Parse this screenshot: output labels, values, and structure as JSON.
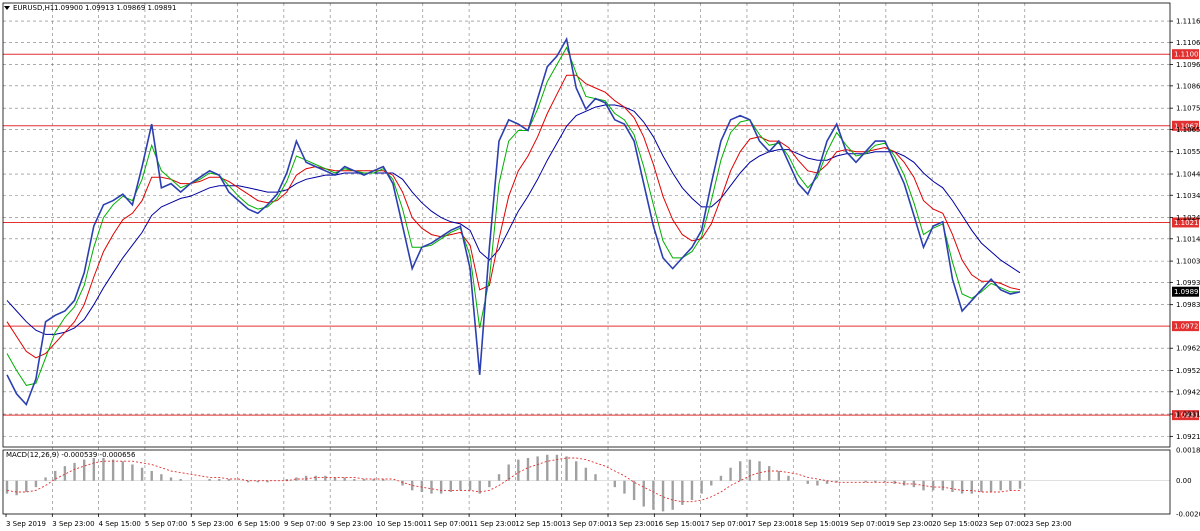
{
  "header": {
    "symbol_label": "EURUSD,H1",
    "ohlc_text": "1.09900 1.09913 1.09869 1.09891",
    "indicator_label": "MACD(12,26,9) -0.000539 -0.000656"
  },
  "colors": {
    "price": "#2b3fb0",
    "ma_fast": "#00b000",
    "ma_mid": "#e00000",
    "ma_slow": "#0000a0",
    "level_line": "#e03030",
    "grid": "#7a7a7a",
    "macd_hist": "#a0a0a0",
    "macd_signal": "#e03030"
  },
  "chart_data": {
    "type": "line",
    "price_axis_ticks": [
      "1.11165",
      "1.11065",
      "1.10960",
      "1.10860",
      "1.10755",
      "1.10655",
      "1.10550",
      "1.10445",
      "1.10345",
      "1.10240",
      "1.10140",
      "1.10035",
      "1.09935",
      "1.09830",
      "1.09625",
      "1.09520",
      "1.09420",
      "1.09315",
      "1.09210"
    ],
    "price_range": [
      1.0916,
      1.1125
    ],
    "current_price": "1.09891",
    "levels": [
      {
        "price": 1.11009,
        "label": "1.11009"
      },
      {
        "price": 1.10672,
        "label": "1.10672"
      },
      {
        "price": 1.10217,
        "label": "1.10217"
      },
      {
        "price": 1.09729,
        "label": "1.09729"
      },
      {
        "price": 1.0931,
        "label": "1.09310"
      }
    ],
    "time_labels": [
      "3 Sep 2019",
      "3 Sep 23:00",
      "4 Sep 15:00",
      "5 Sep 07:00",
      "5 Sep 23:00",
      "6 Sep 15:00",
      "9 Sep 07:00",
      "9 Sep 23:00",
      "10 Sep 15:00",
      "11 Sep 07:00",
      "11 Sep 23:00",
      "12 Sep 15:00",
      "13 Sep 07:00",
      "13 Sep 23:00",
      "16 Sep 15:00",
      "17 Sep 07:00",
      "17 Sep 23:00",
      "18 Sep 15:00",
      "19 Sep 07:00",
      "19 Sep 23:00",
      "20 Sep 15:00",
      "23 Sep 07:00",
      "23 Sep 23:00"
    ],
    "series": [
      {
        "key": "price",
        "values": [
          1.095,
          1.0941,
          1.0936,
          1.0948,
          1.0975,
          1.0978,
          1.098,
          1.0985,
          1.0998,
          1.102,
          1.103,
          1.1032,
          1.1035,
          1.103,
          1.1048,
          1.1068,
          1.1038,
          1.104,
          1.1036,
          1.104,
          1.1043,
          1.1046,
          1.1044,
          1.1036,
          1.1032,
          1.1028,
          1.1026,
          1.103,
          1.1035,
          1.1045,
          1.106,
          1.105,
          1.1048,
          1.1046,
          1.1044,
          1.1048,
          1.1046,
          1.1044,
          1.1046,
          1.1048,
          1.104,
          1.102,
          1.1,
          1.101,
          1.1012,
          1.1015,
          1.1018,
          1.102,
          1.1,
          1.095,
          1.101,
          1.106,
          1.107,
          1.1068,
          1.1065,
          1.108,
          1.1095,
          1.11,
          1.1108,
          1.1085,
          1.1075,
          1.108,
          1.1078,
          1.107,
          1.1068,
          1.106,
          1.104,
          1.102,
          1.1005,
          1.1,
          1.1005,
          1.101,
          1.1018,
          1.104,
          1.106,
          1.107,
          1.1072,
          1.107,
          1.106,
          1.1055,
          1.106,
          1.105,
          1.104,
          1.1035,
          1.1045,
          1.106,
          1.1068,
          1.1055,
          1.105,
          1.1055,
          1.106,
          1.106,
          1.105,
          1.104,
          1.1025,
          1.101,
          1.102,
          1.1022,
          1.0995,
          1.098,
          1.0985,
          1.099,
          1.0995,
          1.099,
          1.0988,
          1.0989
        ]
      },
      {
        "key": "ma_fast",
        "values": [
          1.096,
          1.0952,
          1.0945,
          1.0946,
          1.0958,
          1.097,
          1.0977,
          1.0982,
          1.0992,
          1.101,
          1.1024,
          1.103,
          1.1034,
          1.1032,
          1.1042,
          1.1058,
          1.1046,
          1.1042,
          1.1038,
          1.104,
          1.1042,
          1.1045,
          1.1044,
          1.1039,
          1.1034,
          1.103,
          1.1028,
          1.1029,
          1.1033,
          1.1041,
          1.1053,
          1.1051,
          1.1049,
          1.1047,
          1.1045,
          1.1047,
          1.1046,
          1.1045,
          1.1045,
          1.1047,
          1.1042,
          1.1028,
          1.101,
          1.101,
          1.1011,
          1.1014,
          1.1017,
          1.1019,
          1.1006,
          1.0972,
          1.0995,
          1.104,
          1.106,
          1.1065,
          1.1065,
          1.1075,
          1.1088,
          1.1096,
          1.1104,
          1.1092,
          1.1081,
          1.108,
          1.1079,
          1.1073,
          1.107,
          1.1063,
          1.1048,
          1.103,
          1.1013,
          1.1005,
          1.1005,
          1.1008,
          1.1015,
          1.1032,
          1.1051,
          1.1064,
          1.1069,
          1.107,
          1.1063,
          1.1058,
          1.1059,
          1.1053,
          1.1044,
          1.1038,
          1.1043,
          1.1055,
          1.1064,
          1.1058,
          1.1053,
          1.1054,
          1.1058,
          1.1059,
          1.1053,
          1.1044,
          1.1031,
          1.1016,
          1.1019,
          1.1021,
          1.1003,
          1.0988,
          1.0986,
          1.0989,
          1.0993,
          1.0991,
          1.0989,
          1.0989
        ]
      },
      {
        "key": "ma_mid",
        "values": [
          1.0975,
          1.0968,
          1.0961,
          1.0958,
          1.096,
          1.0965,
          1.097,
          1.0975,
          1.0983,
          1.0996,
          1.1008,
          1.1016,
          1.1023,
          1.1026,
          1.1032,
          1.1043,
          1.1043,
          1.1042,
          1.104,
          1.104,
          1.1041,
          1.1043,
          1.1043,
          1.1041,
          1.1038,
          1.1035,
          1.1032,
          1.1031,
          1.1032,
          1.1036,
          1.1044,
          1.1047,
          1.1048,
          1.1047,
          1.1046,
          1.1046,
          1.1046,
          1.1046,
          1.1046,
          1.1046,
          1.1044,
          1.1036,
          1.1024,
          1.1019,
          1.1016,
          1.1015,
          1.1016,
          1.1017,
          1.1011,
          1.099,
          1.0992,
          1.1014,
          1.1034,
          1.1046,
          1.1053,
          1.1062,
          1.1073,
          1.1082,
          1.1091,
          1.1091,
          1.1087,
          1.1085,
          1.1083,
          1.1079,
          1.1076,
          1.1071,
          1.1062,
          1.1049,
          1.1034,
          1.1023,
          1.1016,
          1.1013,
          1.1014,
          1.1021,
          1.1033,
          1.1046,
          1.1055,
          1.1061,
          1.1062,
          1.106,
          1.106,
          1.1057,
          1.1051,
          1.1046,
          1.1045,
          1.1049,
          1.1055,
          1.1056,
          1.1055,
          1.1055,
          1.1056,
          1.1057,
          1.1055,
          1.105,
          1.1043,
          1.1032,
          1.1028,
          1.1026,
          1.1016,
          1.1004,
          1.0997,
          1.0994,
          1.0994,
          1.0993,
          1.0991,
          1.099
        ]
      },
      {
        "key": "ma_slow",
        "values": [
          1.0985,
          1.098,
          1.0975,
          1.0971,
          1.0969,
          1.0969,
          1.097,
          1.0972,
          1.0976,
          1.0983,
          1.0991,
          1.0998,
          1.1005,
          1.1011,
          1.1017,
          1.1025,
          1.1029,
          1.1031,
          1.1033,
          1.1034,
          1.1036,
          1.1038,
          1.1039,
          1.1039,
          1.1039,
          1.1038,
          1.1037,
          1.1036,
          1.1036,
          1.1037,
          1.104,
          1.1042,
          1.1043,
          1.1044,
          1.1044,
          1.1045,
          1.1045,
          1.1045,
          1.1045,
          1.1045,
          1.1045,
          1.1042,
          1.1036,
          1.1031,
          1.1027,
          1.1024,
          1.1022,
          1.1021,
          1.1018,
          1.1008,
          1.1004,
          1.1009,
          1.1018,
          1.1027,
          1.1034,
          1.1042,
          1.1051,
          1.1059,
          1.1067,
          1.1072,
          1.1074,
          1.1076,
          1.1077,
          1.1077,
          1.1076,
          1.1074,
          1.1069,
          1.1062,
          1.1053,
          1.1045,
          1.1038,
          1.1033,
          1.1029,
          1.1029,
          1.1033,
          1.1039,
          1.1045,
          1.105,
          1.1053,
          1.1055,
          1.1056,
          1.1056,
          1.1054,
          1.1052,
          1.1051,
          1.1051,
          1.1053,
          1.1054,
          1.1054,
          1.1054,
          1.1055,
          1.1055,
          1.1055,
          1.1053,
          1.105,
          1.1045,
          1.1041,
          1.1038,
          1.1032,
          1.1025,
          1.1018,
          1.1012,
          1.1008,
          1.1004,
          1.1001,
          1.0998
        ]
      }
    ],
    "macd": {
      "zero_label": "0.00",
      "ticks": [
        "0.001895",
        "0.00",
        "-0.00206"
      ],
      "range": [
        -0.00206,
        0.001895
      ],
      "histogram": [
        -0.0008,
        -0.0009,
        -0.0007,
        -0.0004,
        0.0002,
        0.0006,
        0.0009,
        0.0011,
        0.0013,
        0.0014,
        0.0014,
        0.0013,
        0.0012,
        0.001,
        0.0008,
        0.0006,
        0.0004,
        0.0002,
        0.0001,
        0.0,
        0.0,
        0.0001,
        0.0001,
        0.0001,
        0.0,
        -0.0001,
        -0.0001,
        -0.0001,
        0.0,
        0.0001,
        0.0002,
        0.0003,
        0.0003,
        0.0003,
        0.0002,
        0.0002,
        0.0001,
        0.0001,
        0.0001,
        0.0001,
        0.0,
        -0.0003,
        -0.0006,
        -0.0007,
        -0.0008,
        -0.0008,
        -0.0007,
        -0.0006,
        -0.0006,
        -0.0008,
        -0.0004,
        0.0004,
        0.001,
        0.0013,
        0.0014,
        0.0015,
        0.0016,
        0.0016,
        0.0015,
        0.0012,
        0.0008,
        0.0004,
        0.0,
        -0.0004,
        -0.0008,
        -0.0012,
        -0.0016,
        -0.0018,
        -0.0019,
        -0.0018,
        -0.0015,
        -0.0012,
        -0.0008,
        -0.0003,
        0.0003,
        0.0008,
        0.0012,
        0.0013,
        0.0012,
        0.0009,
        0.0006,
        0.0003,
        0.0,
        -0.0002,
        -0.0003,
        -0.0002,
        -0.0001,
        0.0,
        0.0,
        -0.0001,
        -0.0001,
        -0.0001,
        -0.0002,
        -0.0003,
        -0.0004,
        -0.0006,
        -0.0006,
        -0.0006,
        -0.0007,
        -0.0008,
        -0.0008,
        -0.0007,
        -0.0007,
        -0.0006,
        -0.0006,
        -0.0005
      ],
      "signal": [
        -0.0006,
        -0.0007,
        -0.0007,
        -0.0006,
        -0.0003,
        0.0001,
        0.0004,
        0.0007,
        0.0009,
        0.0011,
        0.0012,
        0.0012,
        0.0012,
        0.0012,
        0.0011,
        0.001,
        0.0008,
        0.0006,
        0.0005,
        0.0004,
        0.0003,
        0.0002,
        0.0002,
        0.0001,
        0.0001,
        0.0,
        0.0,
        0.0,
        0.0,
        0.0,
        0.0001,
        0.0001,
        0.0002,
        0.0002,
        0.0002,
        0.0002,
        0.0002,
        0.0001,
        0.0001,
        0.0001,
        0.0001,
        -0.0001,
        -0.0003,
        -0.0004,
        -0.0005,
        -0.0006,
        -0.0006,
        -0.0006,
        -0.0006,
        -0.0007,
        -0.0006,
        -0.0003,
        0.0001,
        0.0005,
        0.0008,
        0.001,
        0.0012,
        0.0013,
        0.0014,
        0.0014,
        0.0013,
        0.0011,
        0.0009,
        0.0006,
        0.0003,
        -0.0001,
        -0.0004,
        -0.0007,
        -0.001,
        -0.0012,
        -0.0013,
        -0.0013,
        -0.0012,
        -0.001,
        -0.0007,
        -0.0003,
        0.0,
        0.0003,
        0.0005,
        0.0006,
        0.0006,
        0.0005,
        0.0004,
        0.0002,
        0.0001,
        0.0,
        -0.0001,
        -0.0001,
        -0.0001,
        -0.0001,
        -0.0001,
        -0.0001,
        -0.0001,
        -0.0002,
        -0.0002,
        -0.0003,
        -0.0004,
        -0.0004,
        -0.0005,
        -0.0006,
        -0.0006,
        -0.0007,
        -0.0007,
        -0.0007,
        -0.0006,
        -0.0006
      ]
    }
  }
}
